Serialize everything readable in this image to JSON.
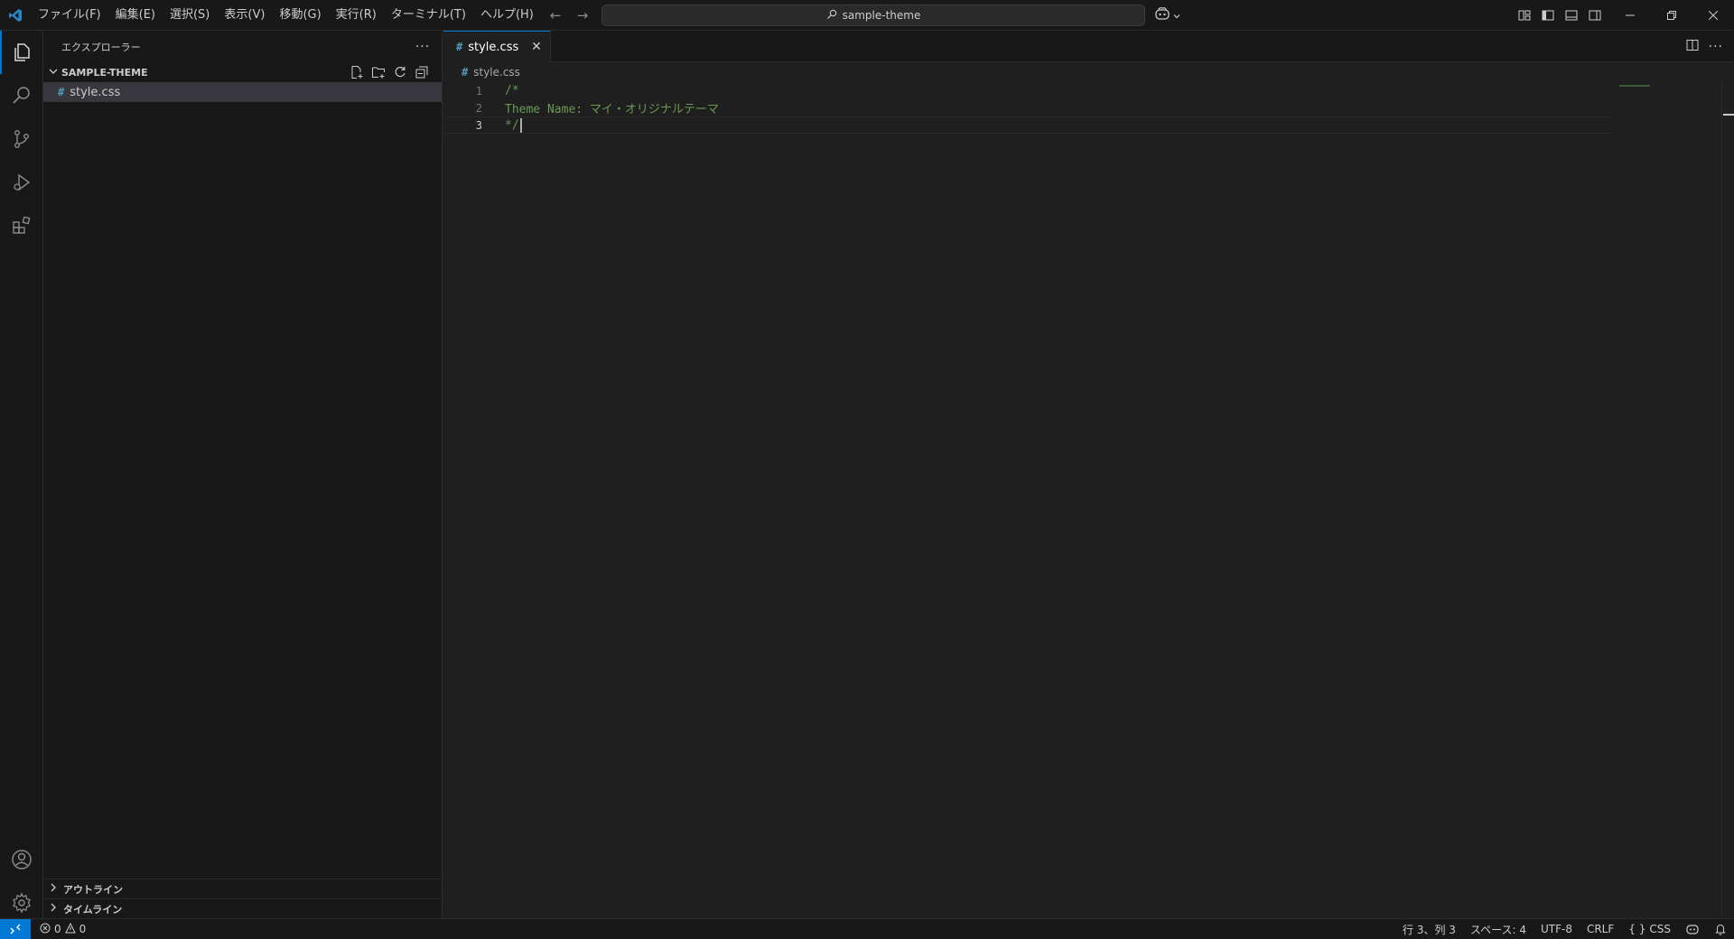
{
  "titlebar": {
    "menu": [
      "ファイル(F)",
      "編集(E)",
      "選択(S)",
      "表示(V)",
      "移動(G)",
      "実行(R)",
      "ターミナル(T)",
      "ヘルプ(H)"
    ],
    "search_text": "sample-theme"
  },
  "sidebar": {
    "title": "エクスプローラー",
    "folder": "SAMPLE-THEME",
    "files": [
      "style.css"
    ],
    "outline": "アウトライン",
    "timeline": "タイムライン"
  },
  "editor": {
    "tab_label": "style.css",
    "breadcrumb": "style.css",
    "lines": [
      {
        "num": "1",
        "text": "/*"
      },
      {
        "num": "2",
        "text": "Theme Name: マイ・オリジナルテーマ"
      },
      {
        "num": "3",
        "text": "*/"
      }
    ]
  },
  "statusbar": {
    "errors": "0",
    "warnings": "0",
    "position": "行 3、列 3",
    "spaces": "スペース: 4",
    "encoding": "UTF-8",
    "eol": "CRLF",
    "language": "CSS"
  },
  "colors": {
    "accent": "#0078d4",
    "comment": "#6a9955",
    "css_icon": "#519aba"
  }
}
